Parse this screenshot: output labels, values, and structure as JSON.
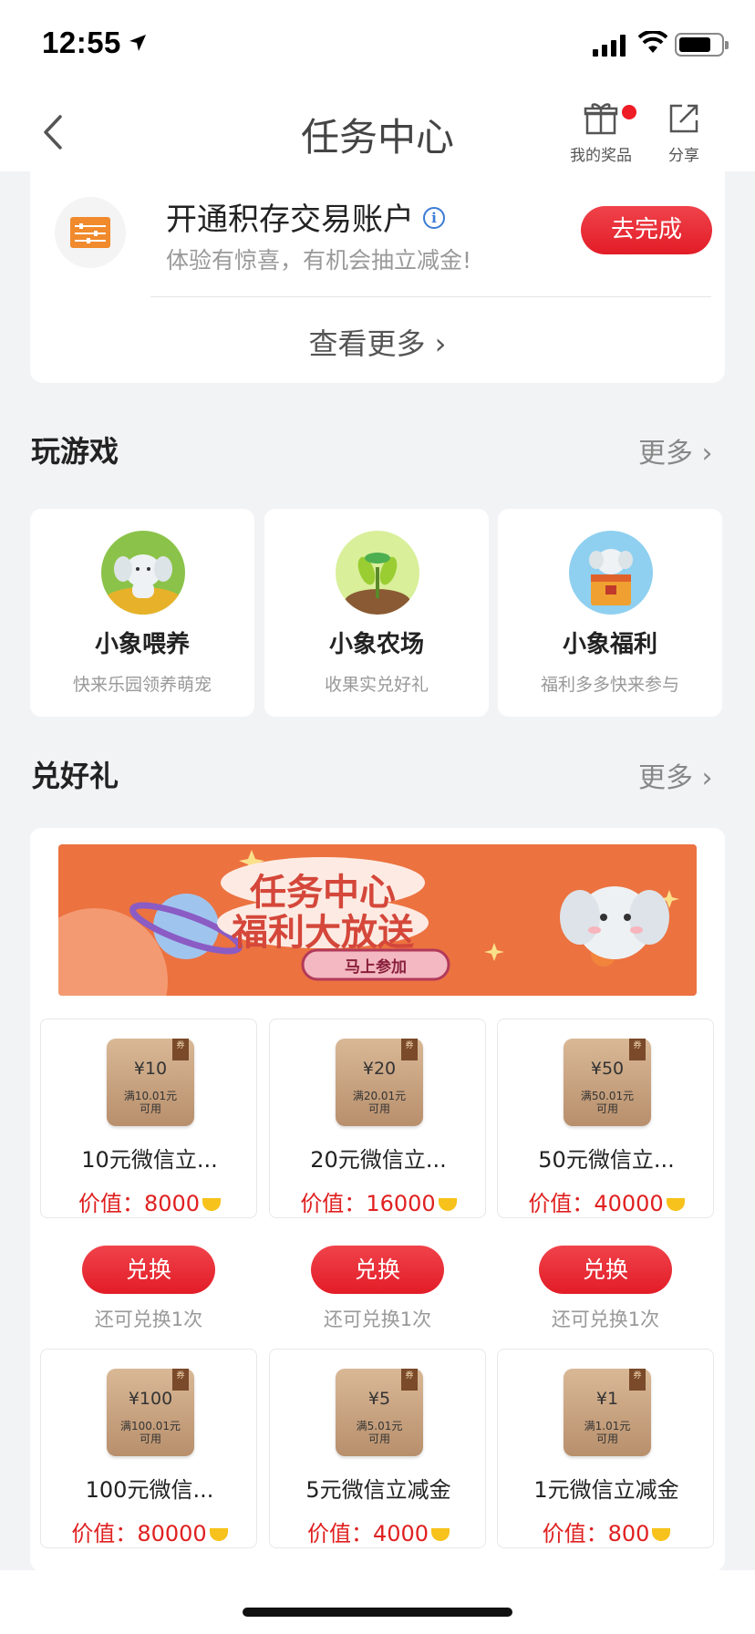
{
  "status_bar": {
    "time": "12:55"
  },
  "nav": {
    "title": "任务中心",
    "prizes_label": "我的奖品",
    "share_label": "分享"
  },
  "task": {
    "title": "开通积存交易账户",
    "info_symbol": "i",
    "subtitle": "体验有惊喜，有机会抽立减金!",
    "button": "去完成",
    "see_more": "查看更多 ›"
  },
  "games_section": {
    "title": "玩游戏",
    "more": "更多 ›"
  },
  "games": [
    {
      "name": "小象喂养",
      "desc": "快来乐园领养萌宠"
    },
    {
      "name": "小象农场",
      "desc": "收果实兑好礼"
    },
    {
      "name": "小象福利",
      "desc": "福利多多快来参与"
    }
  ],
  "gifts_section": {
    "title": "兑好礼",
    "more": "更多 ›"
  },
  "banner": {
    "line1": "任务中心",
    "line2": "福利大放送",
    "cta": "马上参加"
  },
  "gifts": [
    {
      "amount": "¥10",
      "cond1": "满10.01元",
      "cond2": "可用",
      "tag": "券",
      "title": "10元微信立...",
      "price_label": "价值：",
      "price": "8000",
      "button": "兑换",
      "remain": "还可兑换1次"
    },
    {
      "amount": "¥20",
      "cond1": "满20.01元",
      "cond2": "可用",
      "tag": "券",
      "title": "20元微信立...",
      "price_label": "价值：",
      "price": "16000",
      "button": "兑换",
      "remain": "还可兑换1次"
    },
    {
      "amount": "¥50",
      "cond1": "满50.01元",
      "cond2": "可用",
      "tag": "券",
      "title": "50元微信立...",
      "price_label": "价值：",
      "price": "40000",
      "button": "兑换",
      "remain": "还可兑换1次"
    },
    {
      "amount": "¥100",
      "cond1": "满100.01元",
      "cond2": "可用",
      "tag": "券",
      "title": "100元微信...",
      "price_label": "价值：",
      "price": "80000"
    },
    {
      "amount": "¥5",
      "cond1": "满5.01元",
      "cond2": "可用",
      "tag": "券",
      "title": "5元微信立减金",
      "price_label": "价值：",
      "price": "4000"
    },
    {
      "amount": "¥1",
      "cond1": "满1.01元",
      "cond2": "可用",
      "tag": "券",
      "title": "1元微信立减金",
      "price_label": "价值：",
      "price": "800"
    }
  ],
  "colors": {
    "accent_red": "#e21c27",
    "banner_orange": "#ec7240",
    "coupon_tan": "#c8a07c"
  }
}
